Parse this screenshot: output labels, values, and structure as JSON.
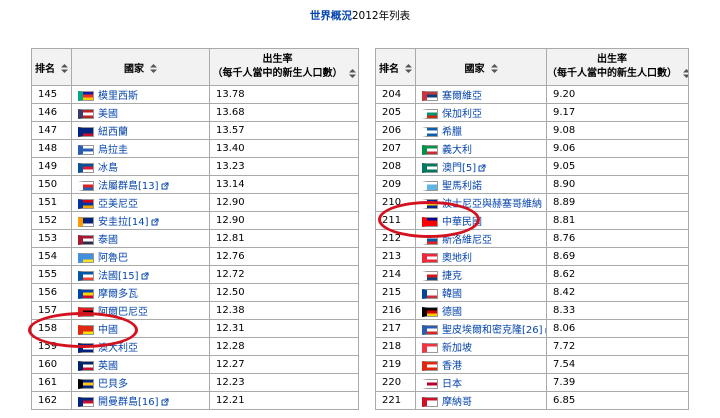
{
  "caption": {
    "link": "世界概況",
    "text": "2012年列表"
  },
  "headers": {
    "rank": "排名",
    "country": "國家",
    "rate_line1": "出生率",
    "rate_line2": "（每千人當中的新生人口數）"
  },
  "left_rows": [
    {
      "rank": "145",
      "name": "模里西斯",
      "ref": "",
      "rate": "13.78",
      "flag": [
        "#1a1aa6",
        "#e32",
        "#fc0",
        "#0a8"
      ]
    },
    {
      "rank": "146",
      "name": "美國",
      "ref": "",
      "rate": "13.68",
      "flag": [
        "#b22",
        "#fff",
        "#b22",
        "#3c3b6e"
      ]
    },
    {
      "rank": "147",
      "name": "紐西蘭",
      "ref": "",
      "rate": "13.57",
      "flag": [
        "#00247d",
        "#00247d",
        "#c8102e",
        "#00247d"
      ]
    },
    {
      "rank": "148",
      "name": "烏拉圭",
      "ref": "",
      "rate": "13.40",
      "flag": [
        "#fff",
        "#2a5db0",
        "#fff",
        "#2a5db0"
      ]
    },
    {
      "rank": "149",
      "name": "冰島",
      "ref": "",
      "rate": "13.23",
      "flag": [
        "#02529c",
        "#dc1e35",
        "#fff",
        "#02529c"
      ]
    },
    {
      "rank": "150",
      "name": "法屬群島",
      "ref": "[13]",
      "rate": "13.14",
      "flag": [
        "#fff",
        "#d22",
        "#2a5db0",
        "#fff"
      ]
    },
    {
      "rank": "151",
      "name": "亞美尼亞",
      "ref": "",
      "rate": "12.90",
      "flag": [
        "#d90012",
        "#0033a0",
        "#f2a800",
        "#0033a0"
      ]
    },
    {
      "rank": "152",
      "name": "安圭拉",
      "ref": "[14]",
      "rate": "12.90",
      "flag": [
        "#00247d",
        "#00247d",
        "#fff",
        "#f90"
      ]
    },
    {
      "rank": "153",
      "name": "泰國",
      "ref": "",
      "rate": "12.81",
      "flag": [
        "#a51931",
        "#fff",
        "#2d2a4a",
        "#a51931"
      ]
    },
    {
      "rank": "154",
      "name": "阿魯巴",
      "ref": "",
      "rate": "12.76",
      "flag": [
        "#418fde",
        "#418fde",
        "#fbe122",
        "#418fde"
      ]
    },
    {
      "rank": "155",
      "name": "法國",
      "ref": "[15]",
      "rate": "12.72",
      "flag": [
        "#0055a4",
        "#fff",
        "#ef4135",
        "#0055a4"
      ]
    },
    {
      "rank": "156",
      "name": "摩爾多瓦",
      "ref": "",
      "rate": "12.50",
      "flag": [
        "#0046ae",
        "#ffd200",
        "#cc092f",
        "#0046ae"
      ]
    },
    {
      "rank": "157",
      "name": "阿爾巴尼亞",
      "ref": "",
      "rate": "12.38",
      "flag": [
        "#e41e20",
        "#000",
        "#e41e20",
        "#e41e20"
      ]
    },
    {
      "rank": "158",
      "name": "中國",
      "ref": "",
      "rate": "12.31",
      "flag": [
        "#de2910",
        "#de2910",
        "#ffde00",
        "#de2910"
      ]
    },
    {
      "rank": "159",
      "name": "澳大利亞",
      "ref": "",
      "rate": "12.28",
      "flag": [
        "#00247d",
        "#fff",
        "#00247d",
        "#00247d"
      ]
    },
    {
      "rank": "160",
      "name": "英國",
      "ref": "",
      "rate": "12.27",
      "flag": [
        "#012169",
        "#fff",
        "#c8102e",
        "#012169"
      ]
    },
    {
      "rank": "161",
      "name": "巴貝多",
      "ref": "",
      "rate": "12.23",
      "flag": [
        "#00267f",
        "#ffc726",
        "#00267f",
        "#000"
      ]
    },
    {
      "rank": "162",
      "name": "開曼群島",
      "ref": "[16]",
      "rate": "12.21",
      "flag": [
        "#00247d",
        "#c8102e",
        "#fff",
        "#00247d"
      ]
    }
  ],
  "right_rows": [
    {
      "rank": "204",
      "name": "塞爾維亞",
      "ref": "",
      "rate": "9.20",
      "flag": [
        "#c6363c",
        "#0c4076",
        "#fff",
        "#c6363c"
      ]
    },
    {
      "rank": "205",
      "name": "保加利亞",
      "ref": "",
      "rate": "9.17",
      "flag": [
        "#fff",
        "#00966e",
        "#d62612",
        "#fff"
      ]
    },
    {
      "rank": "206",
      "name": "希臘",
      "ref": "",
      "rate": "9.08",
      "flag": [
        "#0d5eaf",
        "#fff",
        "#0d5eaf",
        "#fff"
      ]
    },
    {
      "rank": "207",
      "name": "義大利",
      "ref": "",
      "rate": "9.06",
      "flag": [
        "#009246",
        "#fff",
        "#ce2b37",
        "#009246"
      ]
    },
    {
      "rank": "208",
      "name": "澳門",
      "ref": "[5]",
      "rate": "9.05",
      "flag": [
        "#00785e",
        "#fff",
        "#00785e",
        "#00785e"
      ]
    },
    {
      "rank": "209",
      "name": "聖馬利諾",
      "ref": "",
      "rate": "8.90",
      "flag": [
        "#fff",
        "#5eb6e4",
        "#5eb6e4",
        "#fff"
      ]
    },
    {
      "rank": "210",
      "name": "波士尼亞與赫塞哥維納",
      "ref": "",
      "rate": "8.89",
      "flag": [
        "#002395",
        "#fecb00",
        "#002395",
        "#fff"
      ]
    },
    {
      "rank": "211",
      "name": "中華民國",
      "ref": "",
      "rate": "8.81",
      "flag": [
        "#000095",
        "#fe0000",
        "#fe0000",
        "#fe0000"
      ]
    },
    {
      "rank": "212",
      "name": "斯洛維尼亞",
      "ref": "",
      "rate": "8.76",
      "flag": [
        "#fff",
        "#005da4",
        "#ed1c24",
        "#fff"
      ]
    },
    {
      "rank": "213",
      "name": "奧地利",
      "ref": "",
      "rate": "8.69",
      "flag": [
        "#ed2939",
        "#fff",
        "#ed2939",
        "#ed2939"
      ]
    },
    {
      "rank": "214",
      "name": "捷克",
      "ref": "",
      "rate": "8.62",
      "flag": [
        "#fff",
        "#d7141a",
        "#11457e",
        "#fff"
      ]
    },
    {
      "rank": "215",
      "name": "韓國",
      "ref": "",
      "rate": "8.42",
      "flag": [
        "#fff",
        "#fff",
        "#cd2e3a",
        "#0047a0"
      ]
    },
    {
      "rank": "216",
      "name": "德國",
      "ref": "",
      "rate": "8.33",
      "flag": [
        "#000",
        "#dd0000",
        "#ffce00",
        "#000"
      ]
    },
    {
      "rank": "217",
      "name": "聖皮埃爾和密克隆",
      "ref": "[26]",
      "rate": "8.06",
      "flag": [
        "#2a5db0",
        "#fff",
        "#d22",
        "#2a5db0"
      ]
    },
    {
      "rank": "218",
      "name": "新加坡",
      "ref": "",
      "rate": "7.72",
      "flag": [
        "#ef3340",
        "#fff",
        "#fff",
        "#ef3340"
      ]
    },
    {
      "rank": "219",
      "name": "香港",
      "ref": "",
      "rate": "7.54",
      "flag": [
        "#de2910",
        "#fff",
        "#de2910",
        "#de2910"
      ]
    },
    {
      "rank": "220",
      "name": "日本",
      "ref": "",
      "rate": "7.39",
      "flag": [
        "#fff",
        "#bc002d",
        "#fff",
        "#fff"
      ]
    },
    {
      "rank": "221",
      "name": "摩納哥",
      "ref": "",
      "rate": "6.85",
      "flag": [
        "#ce1126",
        "#fff",
        "#fff",
        "#ce1126"
      ]
    }
  ],
  "colors": {
    "link": "#0645ad",
    "highlight": "#d4121f",
    "header_bg": "#f2f2f2",
    "border": "#aaaaaa"
  }
}
